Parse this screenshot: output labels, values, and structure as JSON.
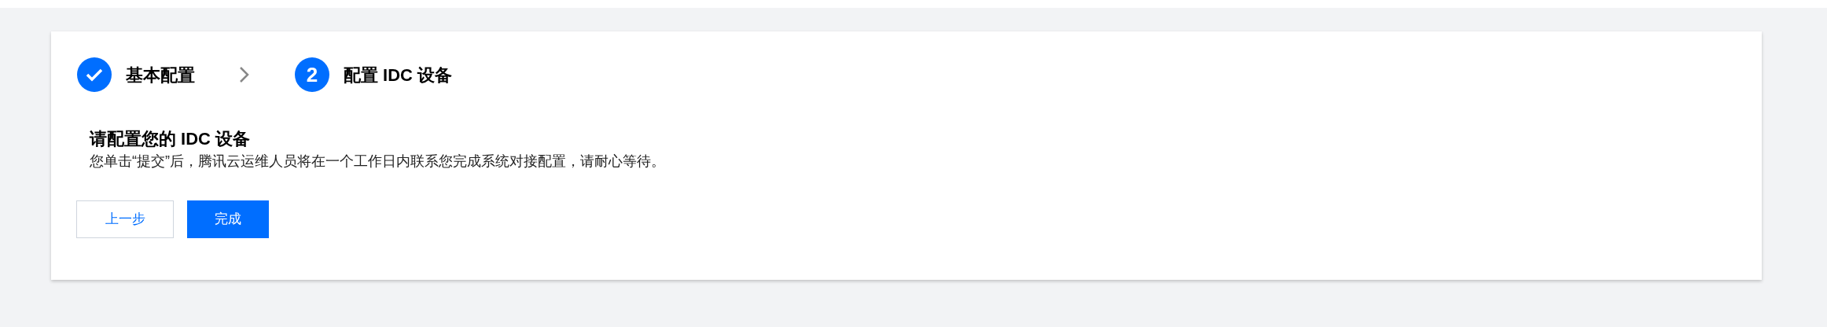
{
  "steps": [
    {
      "completed": true,
      "label": "基本配置"
    },
    {
      "completed": false,
      "number": "2",
      "label": "配置 IDC 设备"
    }
  ],
  "heading": "请配置您的 IDC 设备",
  "description": "您单击“提交”后，腾讯云运维人员将在一个工作日内联系您完成系统对接配置，请耐心等待。",
  "buttons": [
    {
      "kind": "secondary",
      "label": "上一步"
    },
    {
      "kind": "primary",
      "label": "完成"
    }
  ]
}
